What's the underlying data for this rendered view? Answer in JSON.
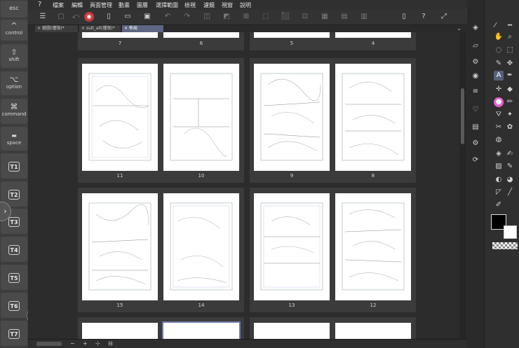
{
  "edge_keyboard": {
    "esc": "esc",
    "control_glyph": "^",
    "control": "control",
    "shift_glyph": "⇧",
    "shift": "shift",
    "option_glyph": "⌥",
    "option": "option",
    "command_glyph": "⌘",
    "command": "command",
    "space_glyph": "▬",
    "space": "space",
    "t_buttons": [
      "T1",
      "T2",
      "T3",
      "T4",
      "T5",
      "T6",
      "T7"
    ]
  },
  "menu": {
    "logo": "?",
    "items": [
      "檔案",
      "編輯",
      "頁面管理",
      "動畫",
      "圖層",
      "選擇範圍",
      "檢視",
      "濾鏡",
      "視窗",
      "說明"
    ]
  },
  "tabs": [
    {
      "label": "繪圖(僅限)*",
      "close": "×"
    },
    {
      "label": "sult_all(僅限)*",
      "close": "×"
    },
    {
      "label": "佈局",
      "close": "×"
    }
  ],
  "tabs_chevron": "⌄",
  "canvas": {
    "top_row_pages": [
      "7",
      "6",
      "5",
      "4"
    ],
    "row2_pages": [
      "11",
      "10",
      "9",
      "8"
    ],
    "row3_pages": [
      "15",
      "14",
      "13",
      "12"
    ]
  },
  "bottombar": {
    "minus": "−",
    "plus": "+"
  },
  "colors": {
    "foreground": "#000000",
    "background": "#ffffff",
    "accent": "#56607a",
    "pink_tool": "#e85fd2"
  }
}
